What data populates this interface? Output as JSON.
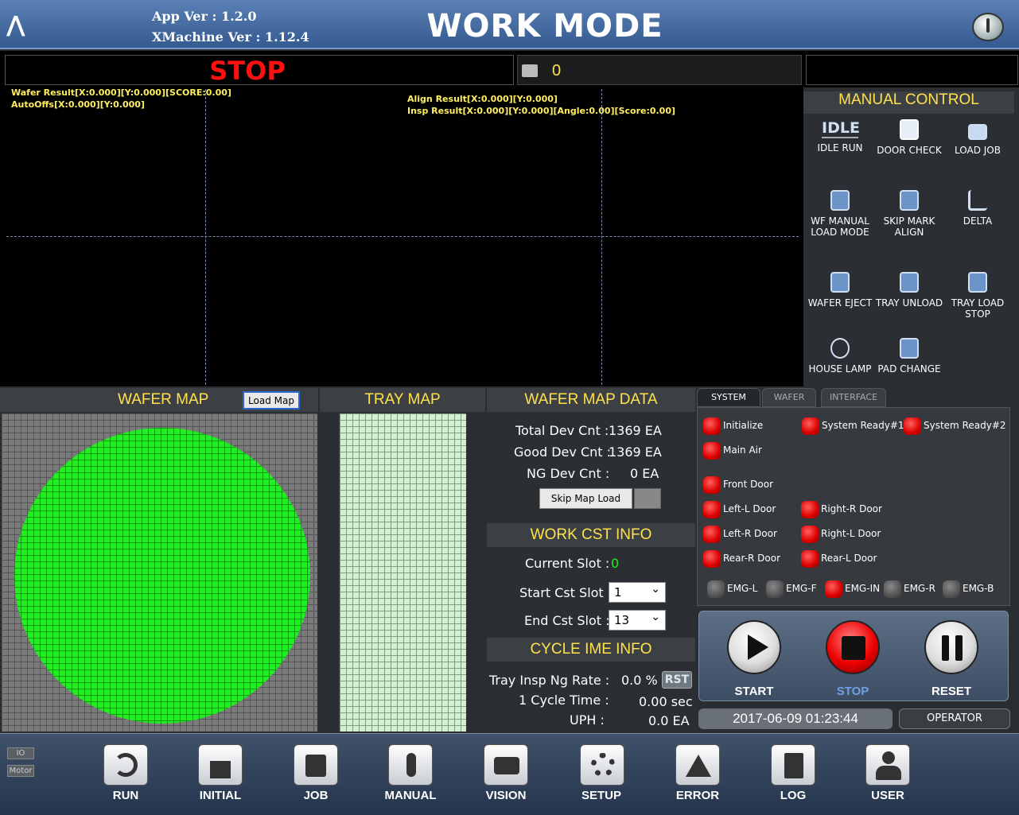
{
  "header": {
    "app_ver": "App Ver : 1.2.0",
    "xmachine_ver": "XMachine Ver : 1.12.4",
    "title": "WORK MODE"
  },
  "status": {
    "state": "STOP",
    "count": "0"
  },
  "vision": {
    "wafer_result": "Wafer Result[X:0.000][Y:0.000][SCORE:0.00]",
    "auto_offs": "AutoOffs[X:0.000][Y:0.000]",
    "align_result": "Align Result[X:0.000][Y:0.000]",
    "insp_result": "Insp Result[X:0.000][Y:0.000][Angle:0.00][Score:0.00]"
  },
  "manual_control": {
    "title": "MANUAL CONTROL",
    "buttons": [
      {
        "label": "IDLE RUN",
        "icon": "idle-icon"
      },
      {
        "label": "DOOR CHECK",
        "icon": "door-icon"
      },
      {
        "label": "LOAD JOB",
        "icon": "folder-icon"
      },
      {
        "label": "WF MANUAL LOAD MODE",
        "icon": "hand-icon"
      },
      {
        "label": "SKIP MARK ALIGN",
        "icon": "hand-icon"
      },
      {
        "label": "DELTA",
        "icon": "ruler-icon"
      },
      {
        "label": "WAFER EJECT",
        "icon": "hand-icon"
      },
      {
        "label": "TRAY UNLOAD",
        "icon": "hand-icon"
      },
      {
        "label": "TRAY LOAD STOP",
        "icon": "hand-icon"
      },
      {
        "label": "HOUSE LAMP",
        "icon": "lamp-icon"
      },
      {
        "label": "PAD CHANGE",
        "icon": "hand-icon"
      }
    ]
  },
  "wafer_map": {
    "title": "WAFER MAP",
    "load_button": "Load Map"
  },
  "tray_map": {
    "title": "TRAY MAP"
  },
  "wafer_map_data": {
    "title": "WAFER MAP DATA",
    "total_label": "Total Dev Cnt :",
    "total": "1369 EA",
    "good_label": "Good Dev Cnt :",
    "good": "1369 EA",
    "ng_label": "NG Dev Cnt :",
    "ng": "0 EA",
    "skip_button": "Skip Map Load"
  },
  "work_cst": {
    "title": "WORK CST INFO",
    "current_label": "Current Slot :",
    "current": "0",
    "start_label": "Start Cst Slot :",
    "start": "1",
    "end_label": "End Cst Slot :",
    "end": "13"
  },
  "cycle": {
    "title": "CYCLE IME INFO",
    "ng_rate_label": "Tray Insp Ng Rate :",
    "ng_rate": "0.0 %",
    "rst": "RST",
    "cycle_label": "1 Cycle Time :",
    "cycle_time": "0.00 sec",
    "uph_label": "UPH :",
    "uph": "0.0 EA"
  },
  "tabs": [
    "SYSTEM",
    "WAFER",
    "INTERFACE"
  ],
  "system": {
    "initialize": "Initialize",
    "ready1": "System Ready#1",
    "ready2": "System Ready#2",
    "main_air": "Main Air",
    "front_door": "Front Door",
    "left_l": "Left-L Door",
    "right_r": "Right-R Door",
    "left_r": "Left-R Door",
    "right_l": "Right-L Door",
    "rear_r": "Rear-R Door",
    "rear_l": "Rear-L Door",
    "emg_l": "EMG-L",
    "emg_f": "EMG-F",
    "emg_in": "EMG-IN",
    "emg_r": "EMG-R",
    "emg_b": "EMG-B"
  },
  "controls": {
    "start": "START",
    "stop": "STOP",
    "reset": "RESET"
  },
  "datetime": "2017-06-09 01:23:44",
  "user_role": "OPERATOR",
  "side": {
    "io": "IO",
    "motor": "Motor"
  },
  "footer": [
    "RUN",
    "INITIAL",
    "JOB",
    "MANUAL",
    "VISION",
    "SETUP",
    "ERROR",
    "LOG",
    "USER"
  ],
  "colors": {
    "accent": "#ffe14a",
    "stop": "#ff1010",
    "wafer": "#1cf21c",
    "header": "#345a90"
  }
}
